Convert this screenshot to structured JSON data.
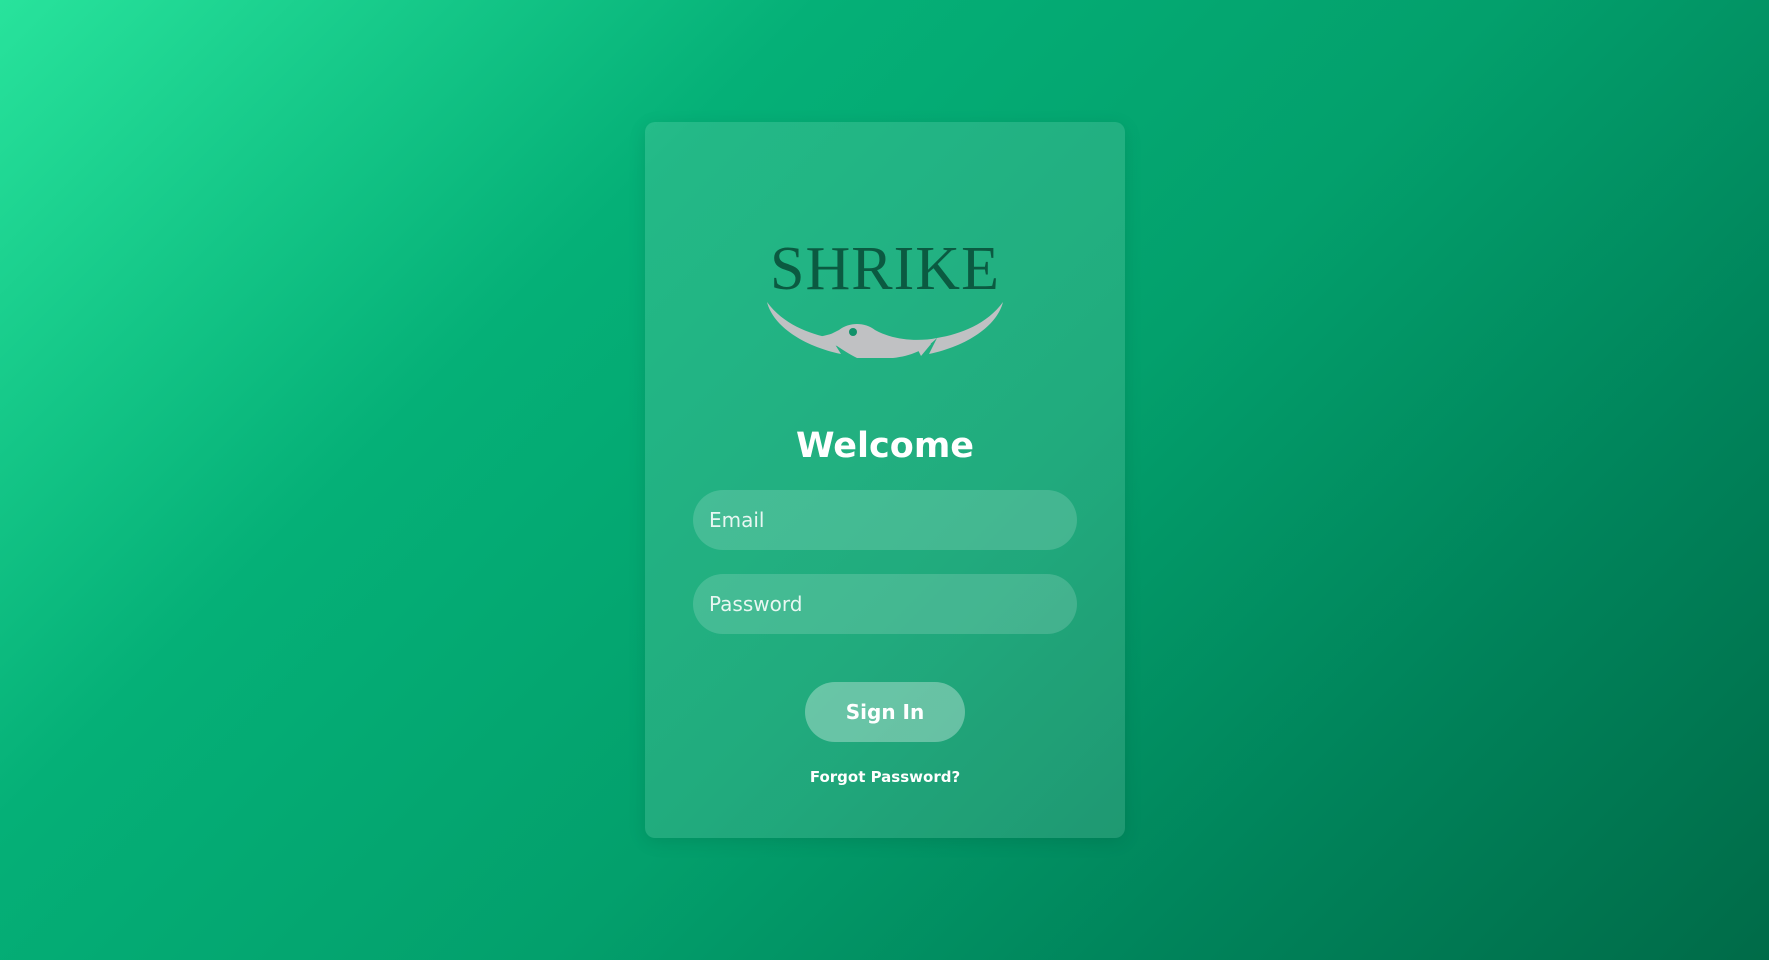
{
  "brand": {
    "name": "SHRIKE",
    "logo_text_color": "#0b5a41",
    "logo_mark_color": "#c0c1c3"
  },
  "login": {
    "heading": "Welcome",
    "email_placeholder": "Email",
    "password_placeholder": "Password",
    "sign_in_label": "Sign In",
    "forgot_password_label": "Forgot Password?"
  },
  "theme": {
    "gradient_start": "#28e39c",
    "gradient_end": "#006b48"
  }
}
